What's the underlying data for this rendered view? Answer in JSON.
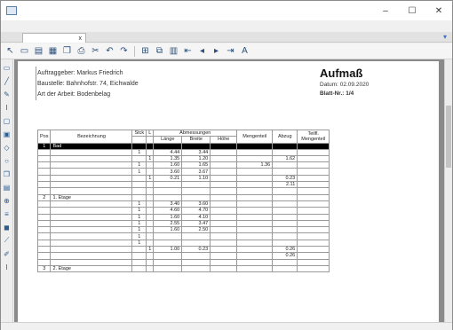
{
  "window": {
    "title": "",
    "min": "–",
    "max": "☐",
    "close": "✕"
  },
  "menu": [],
  "tab": {
    "label": "",
    "close": "x"
  },
  "header": {
    "client_label": "Auftraggeber:",
    "client": "Markus Friedrich",
    "site_label": "Baustelle:",
    "site": "Bahnhofstr. 74, Eichwalde",
    "work_label": "Art der Arbeit:",
    "work": "Bodenbelag",
    "title": "Aufmaß",
    "date_label": "Datum:",
    "date": "02.09.2020",
    "sheet_label": "Blatt-Nr.:",
    "sheet": "1/4"
  },
  "table": {
    "col_pos": "Pos",
    "col_desc": "Bezeichnung",
    "col_stk": "Stck",
    "col_l": "L",
    "col_group": "Abmessungen",
    "col_len": "Länge",
    "col_wid": "Breite",
    "col_hgt": "Höhe",
    "col_menge": "Mengenteil",
    "col_abzug": "Abzug",
    "col_total_1": "Teilfl.",
    "col_total_2": "Mengenteil",
    "rows": [
      {
        "type": "black",
        "pos": "1",
        "desc": "Bad",
        "stk": "",
        "l": "",
        "len": "",
        "wid": "",
        "hgt": "",
        "menge": "",
        "abzug": "",
        "total": ""
      },
      {
        "type": "row",
        "pos": "",
        "desc": "",
        "stk": "1",
        "l": "",
        "len": "4.44",
        "wid": "3.44",
        "hgt": "",
        "menge": "",
        "abzug": "",
        "total": ""
      },
      {
        "type": "row",
        "pos": "",
        "desc": "",
        "stk": "",
        "l": "1",
        "len": "1.35",
        "wid": "1.20",
        "hgt": "",
        "menge": "",
        "abzug": "1.62",
        "total": ""
      },
      {
        "type": "row",
        "pos": "",
        "desc": "",
        "stk": "1",
        "l": "",
        "len": "1.60",
        "wid": "1.65",
        "hgt": "",
        "menge": "1.36",
        "abzug": "",
        "total": ""
      },
      {
        "type": "row",
        "pos": "",
        "desc": "",
        "stk": "1",
        "l": "",
        "len": "3.60",
        "wid": "3.67",
        "hgt": "",
        "menge": "",
        "abzug": "",
        "total": ""
      },
      {
        "type": "row",
        "pos": "",
        "desc": "",
        "stk": "",
        "l": "1",
        "len": "0.21",
        "wid": "1.10",
        "hgt": "",
        "menge": "",
        "abzug": "0.23",
        "total": ""
      },
      {
        "type": "sum",
        "pos": "",
        "desc": "",
        "stk": "",
        "l": "",
        "len": "",
        "wid": "",
        "hgt": "",
        "menge": "",
        "abzug": "2.11",
        "total": ""
      },
      {
        "type": "blank",
        "pos": "",
        "desc": "",
        "stk": "",
        "l": "",
        "len": "",
        "wid": "",
        "hgt": "",
        "menge": "",
        "abzug": "",
        "total": ""
      },
      {
        "type": "row",
        "pos": "2",
        "desc": "1. Etage",
        "stk": "",
        "l": "",
        "len": "",
        "wid": "",
        "hgt": "",
        "menge": "",
        "abzug": "",
        "total": ""
      },
      {
        "type": "row",
        "pos": "",
        "desc": "",
        "stk": "1",
        "l": "",
        "len": "3.40",
        "wid": "3.60",
        "hgt": "",
        "menge": "",
        "abzug": "",
        "total": ""
      },
      {
        "type": "row",
        "pos": "",
        "desc": "",
        "stk": "1",
        "l": "",
        "len": "4.60",
        "wid": "4.70",
        "hgt": "",
        "menge": "",
        "abzug": "",
        "total": ""
      },
      {
        "type": "row",
        "pos": "",
        "desc": "",
        "stk": "1",
        "l": "",
        "len": "1.60",
        "wid": "4.10",
        "hgt": "",
        "menge": "",
        "abzug": "",
        "total": ""
      },
      {
        "type": "row",
        "pos": "",
        "desc": "",
        "stk": "1",
        "l": "",
        "len": "2.55",
        "wid": "3.47",
        "hgt": "",
        "menge": "",
        "abzug": "",
        "total": ""
      },
      {
        "type": "row",
        "pos": "",
        "desc": "",
        "stk": "1",
        "l": "",
        "len": "1.60",
        "wid": "2.50",
        "hgt": "",
        "menge": "",
        "abzug": "",
        "total": ""
      },
      {
        "type": "row",
        "pos": "",
        "desc": "",
        "stk": "1",
        "l": "",
        "len": "",
        "wid": "",
        "hgt": "",
        "menge": "",
        "abzug": "",
        "total": ""
      },
      {
        "type": "row",
        "pos": "",
        "desc": "",
        "stk": "1",
        "l": "",
        "len": "",
        "wid": "",
        "hgt": "",
        "menge": "",
        "abzug": "",
        "total": ""
      },
      {
        "type": "row",
        "pos": "",
        "desc": "",
        "stk": "",
        "l": "1",
        "len": "1.00",
        "wid": "0.23",
        "hgt": "",
        "menge": "",
        "abzug": "0.26",
        "total": ""
      },
      {
        "type": "sum",
        "pos": "",
        "desc": "",
        "stk": "",
        "l": "",
        "len": "",
        "wid": "",
        "hgt": "",
        "menge": "",
        "abzug": "0.26",
        "total": ""
      },
      {
        "type": "blank",
        "pos": "",
        "desc": "",
        "stk": "",
        "l": "",
        "len": "",
        "wid": "",
        "hgt": "",
        "menge": "",
        "abzug": "",
        "total": ""
      },
      {
        "type": "row",
        "pos": "3",
        "desc": "2. Etage",
        "stk": "",
        "l": "",
        "len": "",
        "wid": "",
        "hgt": "",
        "menge": "",
        "abzug": "",
        "total": ""
      }
    ]
  },
  "status": {
    "left": "",
    "right": ""
  },
  "icons": {
    "toolbar": [
      "pointer-icon",
      "new-icon",
      "open-icon",
      "save-icon",
      "copy-icon",
      "print-icon",
      "cut-icon",
      "undo-icon",
      "redo-icon",
      "table-icon",
      "copy-format-icon",
      "grid-icon",
      "first-icon",
      "prev-icon",
      "next-icon",
      "last-icon",
      "text-icon"
    ]
  }
}
